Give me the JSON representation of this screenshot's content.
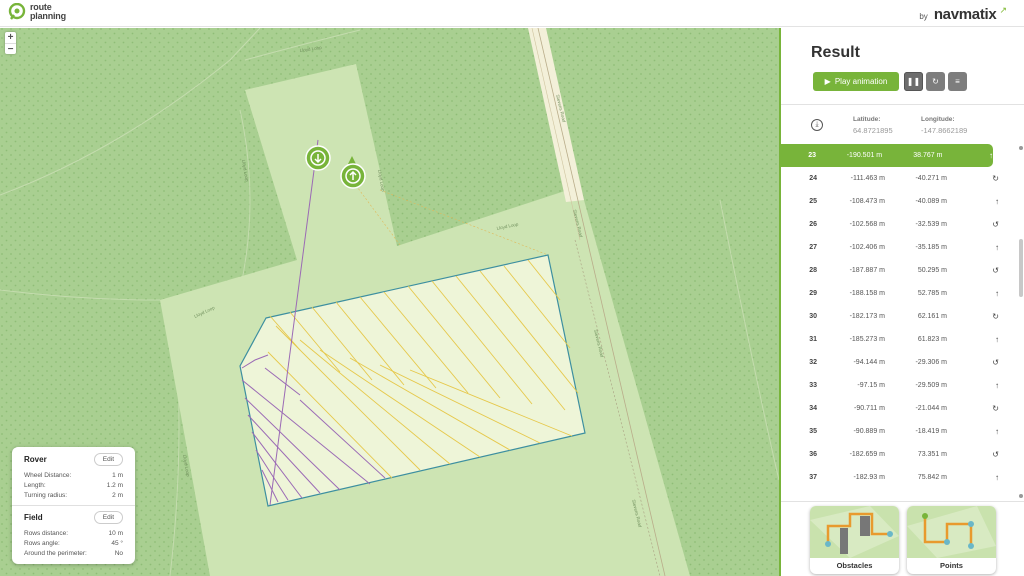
{
  "header": {
    "logo_line1": "route",
    "logo_line2": "planning",
    "by": "by",
    "brand": "navmatix"
  },
  "map": {
    "zoom_in": "+",
    "zoom_out": "−",
    "road_labels": {
      "top": "Lloyd Loop",
      "left_upper": "Lloyd Loop",
      "near_markers": "Lloyd Loop",
      "field_top": "Lloyd Loop",
      "field_left": "Lloyd Loop",
      "left_lower": "Lloyd Loop",
      "road_upper": "Stevens Road",
      "road_mid": "Stevens Road",
      "road_low": "Stevens Road",
      "road_bottom": "Stevens Road"
    }
  },
  "info": {
    "rover_title": "Rover",
    "rover_edit": "Edit",
    "rover_rows": [
      {
        "label": "Wheel Distance:",
        "value": "1 m"
      },
      {
        "label": "Length:",
        "value": "1.2 m"
      },
      {
        "label": "Turning radius:",
        "value": "2 m"
      }
    ],
    "field_title": "Field",
    "field_edit": "Edit",
    "field_rows": [
      {
        "label": "Rows distance:",
        "value": "10 m"
      },
      {
        "label": "Rows angle:",
        "value": "45 °"
      },
      {
        "label": "Around the perimeter:",
        "value": "No"
      }
    ]
  },
  "panel": {
    "title": "Result",
    "play_label": "Play animation",
    "pause_icon": "pause-icon",
    "refresh_icon": "refresh-icon",
    "menu_icon": "list-icon",
    "latitude_label": "Latitude:",
    "latitude_value": "64.8721895",
    "longitude_label": "Longitude:",
    "longitude_value": "-147.8662189",
    "rows": [
      {
        "idx": "23",
        "x": "-190.501 m",
        "y": "38.767 m",
        "icon": "↑",
        "active": true
      },
      {
        "idx": "24",
        "x": "-111.463 m",
        "y": "-40.271 m",
        "icon": "↻"
      },
      {
        "idx": "25",
        "x": "-108.473 m",
        "y": "-40.089 m",
        "icon": "↑"
      },
      {
        "idx": "26",
        "x": "-102.568 m",
        "y": "-32.539 m",
        "icon": "↺"
      },
      {
        "idx": "27",
        "x": "-102.406 m",
        "y": "-35.185 m",
        "icon": "↑"
      },
      {
        "idx": "28",
        "x": "-187.887 m",
        "y": "50.295 m",
        "icon": "↺"
      },
      {
        "idx": "29",
        "x": "-188.158 m",
        "y": "52.785 m",
        "icon": "↑"
      },
      {
        "idx": "30",
        "x": "-182.173 m",
        "y": "62.161 m",
        "icon": "↻"
      },
      {
        "idx": "31",
        "x": "-185.273 m",
        "y": "61.823 m",
        "icon": "↑"
      },
      {
        "idx": "32",
        "x": "-94.144 m",
        "y": "-29.306 m",
        "icon": "↺"
      },
      {
        "idx": "33",
        "x": "-97.15 m",
        "y": "-29.509 m",
        "icon": "↑"
      },
      {
        "idx": "34",
        "x": "-90.711 m",
        "y": "-21.044 m",
        "icon": "↻"
      },
      {
        "idx": "35",
        "x": "-90.889 m",
        "y": "-18.419 m",
        "icon": "↑"
      },
      {
        "idx": "36",
        "x": "-182.659 m",
        "y": "73.351 m",
        "icon": "↺"
      },
      {
        "idx": "37",
        "x": "-182.93 m",
        "y": "75.842 m",
        "icon": "↑"
      }
    ],
    "card_obstacles": "Obstacles",
    "card_points": "Points"
  },
  "colors": {
    "accent": "#78b43a",
    "map_bg": "#a9cf91",
    "field": "#cfe5b4",
    "path_yellow": "#e6c84a",
    "path_purple": "#9b6ab5"
  }
}
